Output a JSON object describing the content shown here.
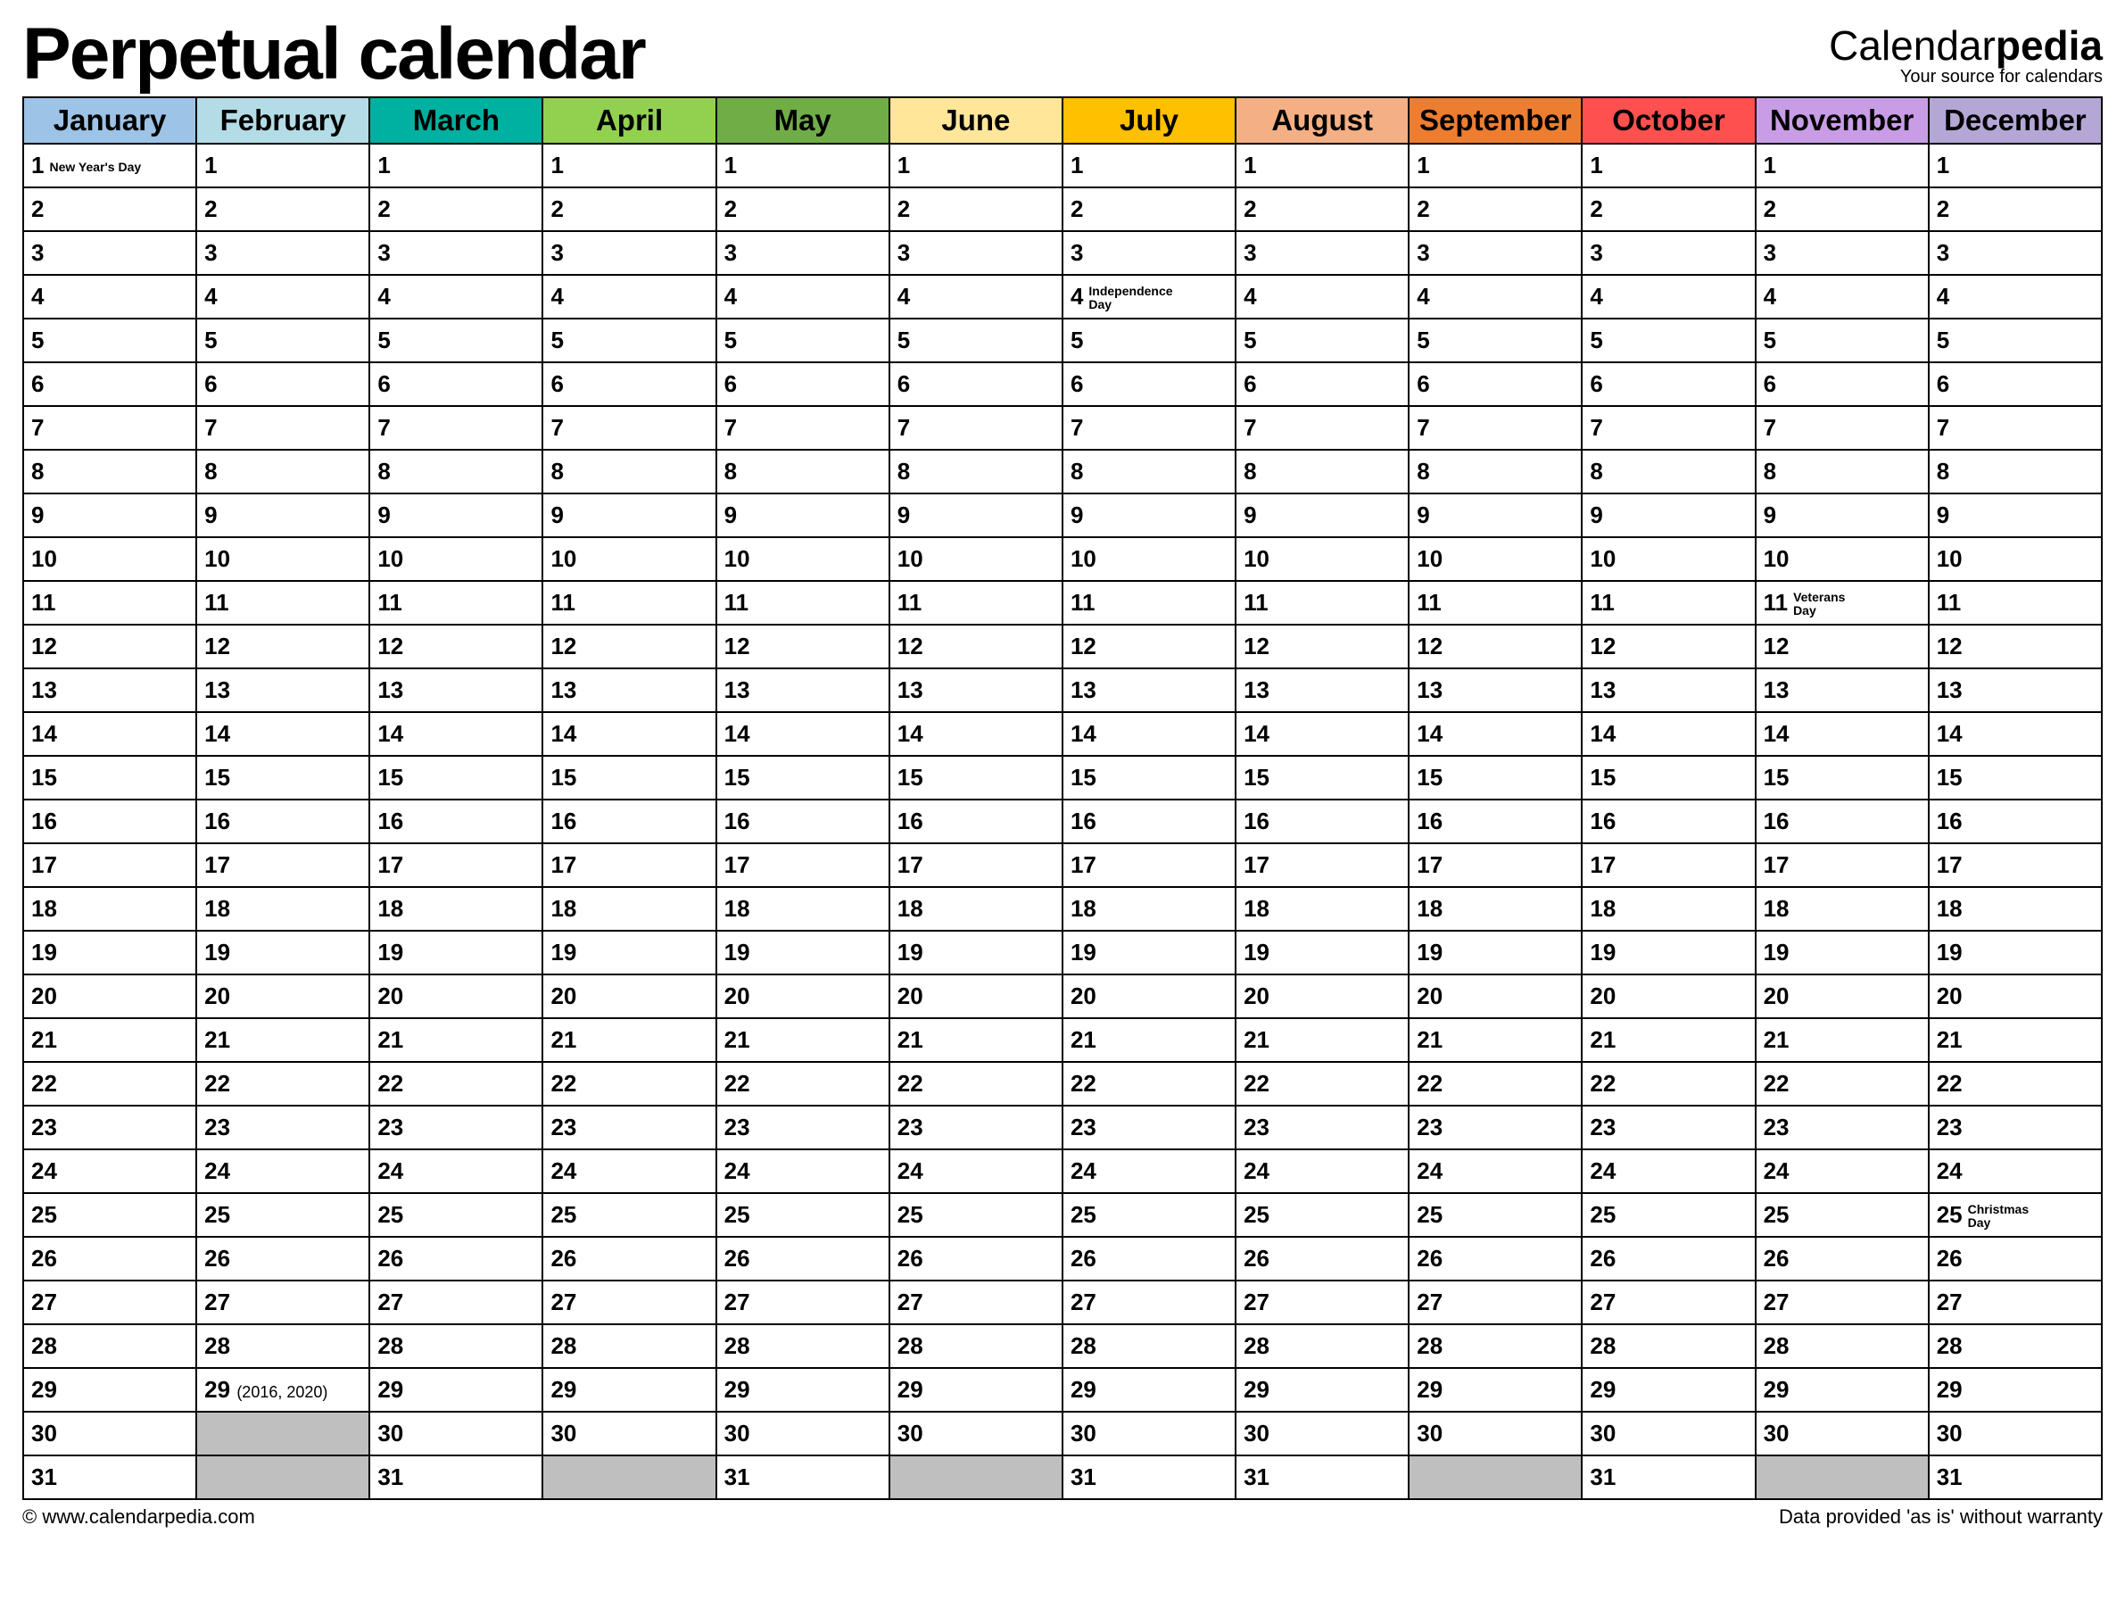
{
  "title": "Perpetual calendar",
  "brand": {
    "prefix": "Calendar",
    "suffix": "pedia",
    "tagline": "Your source for calendars"
  },
  "footer": {
    "left": "© www.calendarpedia.com",
    "right": "Data provided 'as is' without warranty"
  },
  "months": [
    {
      "name": "January",
      "color": "#9dc3e6"
    },
    {
      "name": "February",
      "color": "#b4dce6"
    },
    {
      "name": "March",
      "color": "#00b0a0"
    },
    {
      "name": "April",
      "color": "#92d050"
    },
    {
      "name": "May",
      "color": "#70ad47"
    },
    {
      "name": "June",
      "color": "#ffe699"
    },
    {
      "name": "July",
      "color": "#ffc000"
    },
    {
      "name": "August",
      "color": "#f4b084"
    },
    {
      "name": "September",
      "color": "#ed7d31"
    },
    {
      "name": "October",
      "color": "#ff5050"
    },
    {
      "name": "November",
      "color": "#c99de6"
    },
    {
      "name": "December",
      "color": "#b4a7d6"
    }
  ],
  "rows": [
    [
      {
        "n": "1",
        "holiday": "New Year's Day"
      },
      {
        "n": "1"
      },
      {
        "n": "1"
      },
      {
        "n": "1"
      },
      {
        "n": "1"
      },
      {
        "n": "1"
      },
      {
        "n": "1"
      },
      {
        "n": "1"
      },
      {
        "n": "1"
      },
      {
        "n": "1"
      },
      {
        "n": "1"
      },
      {
        "n": "1"
      }
    ],
    [
      {
        "n": "2"
      },
      {
        "n": "2"
      },
      {
        "n": "2"
      },
      {
        "n": "2"
      },
      {
        "n": "2"
      },
      {
        "n": "2"
      },
      {
        "n": "2"
      },
      {
        "n": "2"
      },
      {
        "n": "2"
      },
      {
        "n": "2"
      },
      {
        "n": "2"
      },
      {
        "n": "2"
      }
    ],
    [
      {
        "n": "3"
      },
      {
        "n": "3"
      },
      {
        "n": "3"
      },
      {
        "n": "3"
      },
      {
        "n": "3"
      },
      {
        "n": "3"
      },
      {
        "n": "3"
      },
      {
        "n": "3"
      },
      {
        "n": "3"
      },
      {
        "n": "3"
      },
      {
        "n": "3"
      },
      {
        "n": "3"
      }
    ],
    [
      {
        "n": "4"
      },
      {
        "n": "4"
      },
      {
        "n": "4"
      },
      {
        "n": "4"
      },
      {
        "n": "4"
      },
      {
        "n": "4"
      },
      {
        "n": "4",
        "holiday": "Independence\nDay"
      },
      {
        "n": "4"
      },
      {
        "n": "4"
      },
      {
        "n": "4"
      },
      {
        "n": "4"
      },
      {
        "n": "4"
      }
    ],
    [
      {
        "n": "5"
      },
      {
        "n": "5"
      },
      {
        "n": "5"
      },
      {
        "n": "5"
      },
      {
        "n": "5"
      },
      {
        "n": "5"
      },
      {
        "n": "5"
      },
      {
        "n": "5"
      },
      {
        "n": "5"
      },
      {
        "n": "5"
      },
      {
        "n": "5"
      },
      {
        "n": "5"
      }
    ],
    [
      {
        "n": "6"
      },
      {
        "n": "6"
      },
      {
        "n": "6"
      },
      {
        "n": "6"
      },
      {
        "n": "6"
      },
      {
        "n": "6"
      },
      {
        "n": "6"
      },
      {
        "n": "6"
      },
      {
        "n": "6"
      },
      {
        "n": "6"
      },
      {
        "n": "6"
      },
      {
        "n": "6"
      }
    ],
    [
      {
        "n": "7"
      },
      {
        "n": "7"
      },
      {
        "n": "7"
      },
      {
        "n": "7"
      },
      {
        "n": "7"
      },
      {
        "n": "7"
      },
      {
        "n": "7"
      },
      {
        "n": "7"
      },
      {
        "n": "7"
      },
      {
        "n": "7"
      },
      {
        "n": "7"
      },
      {
        "n": "7"
      }
    ],
    [
      {
        "n": "8"
      },
      {
        "n": "8"
      },
      {
        "n": "8"
      },
      {
        "n": "8"
      },
      {
        "n": "8"
      },
      {
        "n": "8"
      },
      {
        "n": "8"
      },
      {
        "n": "8"
      },
      {
        "n": "8"
      },
      {
        "n": "8"
      },
      {
        "n": "8"
      },
      {
        "n": "8"
      }
    ],
    [
      {
        "n": "9"
      },
      {
        "n": "9"
      },
      {
        "n": "9"
      },
      {
        "n": "9"
      },
      {
        "n": "9"
      },
      {
        "n": "9"
      },
      {
        "n": "9"
      },
      {
        "n": "9"
      },
      {
        "n": "9"
      },
      {
        "n": "9"
      },
      {
        "n": "9"
      },
      {
        "n": "9"
      }
    ],
    [
      {
        "n": "10"
      },
      {
        "n": "10"
      },
      {
        "n": "10"
      },
      {
        "n": "10"
      },
      {
        "n": "10"
      },
      {
        "n": "10"
      },
      {
        "n": "10"
      },
      {
        "n": "10"
      },
      {
        "n": "10"
      },
      {
        "n": "10"
      },
      {
        "n": "10"
      },
      {
        "n": "10"
      }
    ],
    [
      {
        "n": "11"
      },
      {
        "n": "11"
      },
      {
        "n": "11"
      },
      {
        "n": "11"
      },
      {
        "n": "11"
      },
      {
        "n": "11"
      },
      {
        "n": "11"
      },
      {
        "n": "11"
      },
      {
        "n": "11"
      },
      {
        "n": "11"
      },
      {
        "n": "11",
        "holiday": "Veterans\nDay"
      },
      {
        "n": "11"
      }
    ],
    [
      {
        "n": "12"
      },
      {
        "n": "12"
      },
      {
        "n": "12"
      },
      {
        "n": "12"
      },
      {
        "n": "12"
      },
      {
        "n": "12"
      },
      {
        "n": "12"
      },
      {
        "n": "12"
      },
      {
        "n": "12"
      },
      {
        "n": "12"
      },
      {
        "n": "12"
      },
      {
        "n": "12"
      }
    ],
    [
      {
        "n": "13"
      },
      {
        "n": "13"
      },
      {
        "n": "13"
      },
      {
        "n": "13"
      },
      {
        "n": "13"
      },
      {
        "n": "13"
      },
      {
        "n": "13"
      },
      {
        "n": "13"
      },
      {
        "n": "13"
      },
      {
        "n": "13"
      },
      {
        "n": "13"
      },
      {
        "n": "13"
      }
    ],
    [
      {
        "n": "14"
      },
      {
        "n": "14"
      },
      {
        "n": "14"
      },
      {
        "n": "14"
      },
      {
        "n": "14"
      },
      {
        "n": "14"
      },
      {
        "n": "14"
      },
      {
        "n": "14"
      },
      {
        "n": "14"
      },
      {
        "n": "14"
      },
      {
        "n": "14"
      },
      {
        "n": "14"
      }
    ],
    [
      {
        "n": "15"
      },
      {
        "n": "15"
      },
      {
        "n": "15"
      },
      {
        "n": "15"
      },
      {
        "n": "15"
      },
      {
        "n": "15"
      },
      {
        "n": "15"
      },
      {
        "n": "15"
      },
      {
        "n": "15"
      },
      {
        "n": "15"
      },
      {
        "n": "15"
      },
      {
        "n": "15"
      }
    ],
    [
      {
        "n": "16"
      },
      {
        "n": "16"
      },
      {
        "n": "16"
      },
      {
        "n": "16"
      },
      {
        "n": "16"
      },
      {
        "n": "16"
      },
      {
        "n": "16"
      },
      {
        "n": "16"
      },
      {
        "n": "16"
      },
      {
        "n": "16"
      },
      {
        "n": "16"
      },
      {
        "n": "16"
      }
    ],
    [
      {
        "n": "17"
      },
      {
        "n": "17"
      },
      {
        "n": "17"
      },
      {
        "n": "17"
      },
      {
        "n": "17"
      },
      {
        "n": "17"
      },
      {
        "n": "17"
      },
      {
        "n": "17"
      },
      {
        "n": "17"
      },
      {
        "n": "17"
      },
      {
        "n": "17"
      },
      {
        "n": "17"
      }
    ],
    [
      {
        "n": "18"
      },
      {
        "n": "18"
      },
      {
        "n": "18"
      },
      {
        "n": "18"
      },
      {
        "n": "18"
      },
      {
        "n": "18"
      },
      {
        "n": "18"
      },
      {
        "n": "18"
      },
      {
        "n": "18"
      },
      {
        "n": "18"
      },
      {
        "n": "18"
      },
      {
        "n": "18"
      }
    ],
    [
      {
        "n": "19"
      },
      {
        "n": "19"
      },
      {
        "n": "19"
      },
      {
        "n": "19"
      },
      {
        "n": "19"
      },
      {
        "n": "19"
      },
      {
        "n": "19"
      },
      {
        "n": "19"
      },
      {
        "n": "19"
      },
      {
        "n": "19"
      },
      {
        "n": "19"
      },
      {
        "n": "19"
      }
    ],
    [
      {
        "n": "20"
      },
      {
        "n": "20"
      },
      {
        "n": "20"
      },
      {
        "n": "20"
      },
      {
        "n": "20"
      },
      {
        "n": "20"
      },
      {
        "n": "20"
      },
      {
        "n": "20"
      },
      {
        "n": "20"
      },
      {
        "n": "20"
      },
      {
        "n": "20"
      },
      {
        "n": "20"
      }
    ],
    [
      {
        "n": "21"
      },
      {
        "n": "21"
      },
      {
        "n": "21"
      },
      {
        "n": "21"
      },
      {
        "n": "21"
      },
      {
        "n": "21"
      },
      {
        "n": "21"
      },
      {
        "n": "21"
      },
      {
        "n": "21"
      },
      {
        "n": "21"
      },
      {
        "n": "21"
      },
      {
        "n": "21"
      }
    ],
    [
      {
        "n": "22"
      },
      {
        "n": "22"
      },
      {
        "n": "22"
      },
      {
        "n": "22"
      },
      {
        "n": "22"
      },
      {
        "n": "22"
      },
      {
        "n": "22"
      },
      {
        "n": "22"
      },
      {
        "n": "22"
      },
      {
        "n": "22"
      },
      {
        "n": "22"
      },
      {
        "n": "22"
      }
    ],
    [
      {
        "n": "23"
      },
      {
        "n": "23"
      },
      {
        "n": "23"
      },
      {
        "n": "23"
      },
      {
        "n": "23"
      },
      {
        "n": "23"
      },
      {
        "n": "23"
      },
      {
        "n": "23"
      },
      {
        "n": "23"
      },
      {
        "n": "23"
      },
      {
        "n": "23"
      },
      {
        "n": "23"
      }
    ],
    [
      {
        "n": "24"
      },
      {
        "n": "24"
      },
      {
        "n": "24"
      },
      {
        "n": "24"
      },
      {
        "n": "24"
      },
      {
        "n": "24"
      },
      {
        "n": "24"
      },
      {
        "n": "24"
      },
      {
        "n": "24"
      },
      {
        "n": "24"
      },
      {
        "n": "24"
      },
      {
        "n": "24"
      }
    ],
    [
      {
        "n": "25"
      },
      {
        "n": "25"
      },
      {
        "n": "25"
      },
      {
        "n": "25"
      },
      {
        "n": "25"
      },
      {
        "n": "25"
      },
      {
        "n": "25"
      },
      {
        "n": "25"
      },
      {
        "n": "25"
      },
      {
        "n": "25"
      },
      {
        "n": "25"
      },
      {
        "n": "25",
        "holiday": "Christmas\nDay"
      }
    ],
    [
      {
        "n": "26"
      },
      {
        "n": "26"
      },
      {
        "n": "26"
      },
      {
        "n": "26"
      },
      {
        "n": "26"
      },
      {
        "n": "26"
      },
      {
        "n": "26"
      },
      {
        "n": "26"
      },
      {
        "n": "26"
      },
      {
        "n": "26"
      },
      {
        "n": "26"
      },
      {
        "n": "26"
      }
    ],
    [
      {
        "n": "27"
      },
      {
        "n": "27"
      },
      {
        "n": "27"
      },
      {
        "n": "27"
      },
      {
        "n": "27"
      },
      {
        "n": "27"
      },
      {
        "n": "27"
      },
      {
        "n": "27"
      },
      {
        "n": "27"
      },
      {
        "n": "27"
      },
      {
        "n": "27"
      },
      {
        "n": "27"
      }
    ],
    [
      {
        "n": "28"
      },
      {
        "n": "28"
      },
      {
        "n": "28"
      },
      {
        "n": "28"
      },
      {
        "n": "28"
      },
      {
        "n": "28"
      },
      {
        "n": "28"
      },
      {
        "n": "28"
      },
      {
        "n": "28"
      },
      {
        "n": "28"
      },
      {
        "n": "28"
      },
      {
        "n": "28"
      }
    ],
    [
      {
        "n": "29"
      },
      {
        "n": "29",
        "leap": "(2016, 2020)"
      },
      {
        "n": "29"
      },
      {
        "n": "29"
      },
      {
        "n": "29"
      },
      {
        "n": "29"
      },
      {
        "n": "29"
      },
      {
        "n": "29"
      },
      {
        "n": "29"
      },
      {
        "n": "29"
      },
      {
        "n": "29"
      },
      {
        "n": "29"
      }
    ],
    [
      {
        "n": "30"
      },
      {
        "empty": true
      },
      {
        "n": "30"
      },
      {
        "n": "30"
      },
      {
        "n": "30"
      },
      {
        "n": "30"
      },
      {
        "n": "30"
      },
      {
        "n": "30"
      },
      {
        "n": "30"
      },
      {
        "n": "30"
      },
      {
        "n": "30"
      },
      {
        "n": "30"
      }
    ],
    [
      {
        "n": "31"
      },
      {
        "empty": true
      },
      {
        "n": "31"
      },
      {
        "empty": true
      },
      {
        "n": "31"
      },
      {
        "empty": true
      },
      {
        "n": "31"
      },
      {
        "n": "31"
      },
      {
        "empty": true
      },
      {
        "n": "31"
      },
      {
        "empty": true
      },
      {
        "n": "31"
      }
    ]
  ]
}
